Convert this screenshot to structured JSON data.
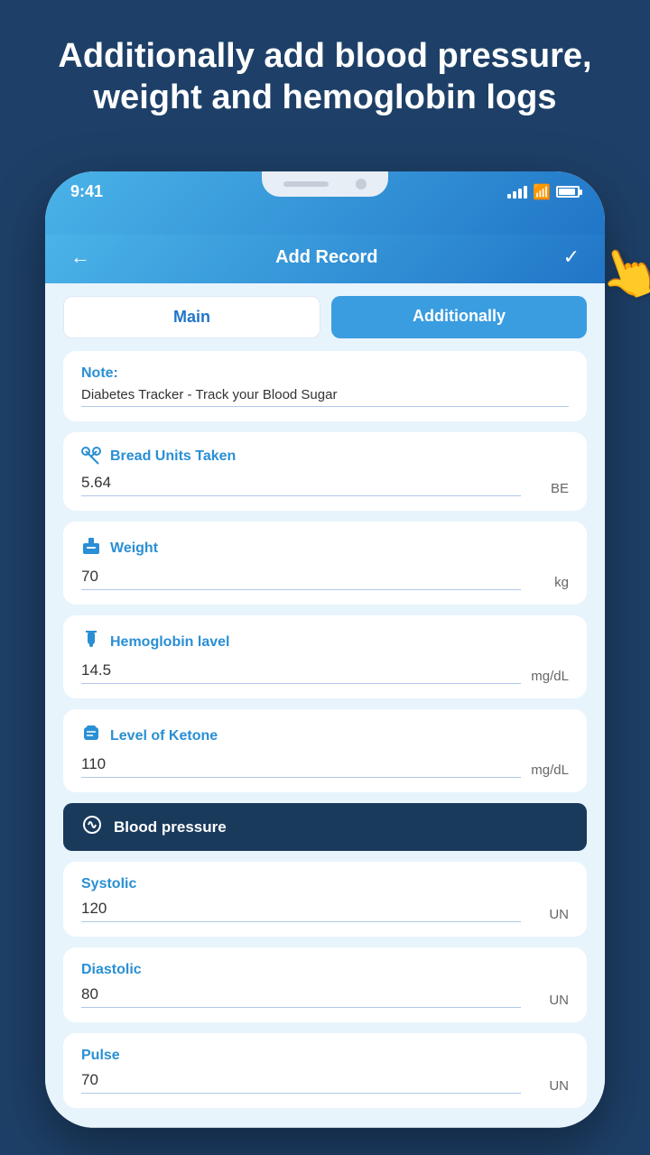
{
  "headline": {
    "line1": "Additionally add blood pressure,",
    "line2": "weight and hemoglobin logs"
  },
  "status_bar": {
    "time": "9:41",
    "signal": "signal",
    "wifi": "wifi",
    "battery": "battery"
  },
  "app_bar": {
    "title": "Add Record",
    "back_label": "←",
    "check_label": "✓"
  },
  "tabs": {
    "main_label": "Main",
    "additionally_label": "Additionally"
  },
  "note": {
    "label": "Note:",
    "value": "Diabetes Tracker - Track your Blood Sugar"
  },
  "bread_units": {
    "label": "Bread Units Taken",
    "value": "5.64",
    "unit": "BE"
  },
  "weight": {
    "label": "Weight",
    "value": "70",
    "unit": "kg"
  },
  "hemoglobin": {
    "label": "Hemoglobin lavel",
    "value": "14.5",
    "unit": "mg/dL"
  },
  "ketone": {
    "label": "Level of Ketone",
    "value": "110",
    "unit": "mg/dL"
  },
  "blood_pressure": {
    "section_label": "Blood pressure",
    "systolic": {
      "label": "Systolic",
      "value": "120",
      "unit": "UN"
    },
    "diastolic": {
      "label": "Diastolic",
      "value": "80",
      "unit": "UN"
    },
    "pulse": {
      "label": "Pulse",
      "value": "70",
      "unit": "UN"
    }
  }
}
